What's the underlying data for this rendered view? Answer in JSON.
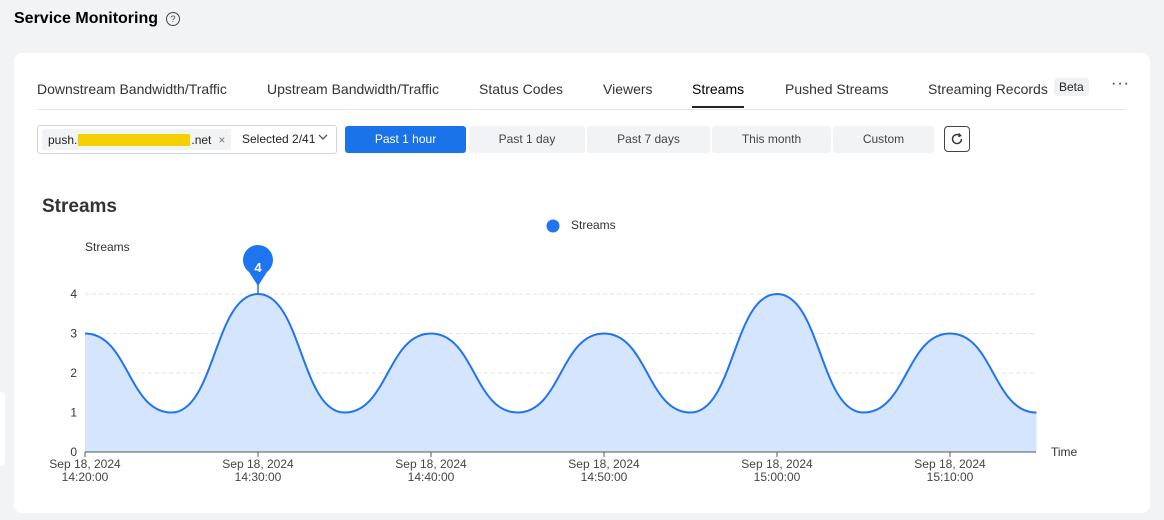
{
  "header": {
    "title": "Service Monitoring",
    "help_icon": "?"
  },
  "tabs": [
    {
      "label": "Downstream Bandwidth/Traffic",
      "active": false
    },
    {
      "label": "Upstream Bandwidth/Traffic",
      "active": false
    },
    {
      "label": "Status Codes",
      "active": false
    },
    {
      "label": "Viewers",
      "active": false
    },
    {
      "label": "Streams",
      "active": true
    },
    {
      "label": "Pushed Streams",
      "active": false
    },
    {
      "label": "Streaming Records",
      "active": false
    }
  ],
  "badge": "Beta",
  "more": "···",
  "filter": {
    "domain_prefix": "push.",
    "domain_suffix": ".net",
    "close": "×",
    "selected": "Selected 2/41"
  },
  "time_ranges": [
    {
      "label": "Past 1 hour",
      "active": true
    },
    {
      "label": "Past 1 day",
      "active": false
    },
    {
      "label": "Past 7 days",
      "active": false
    },
    {
      "label": "This month",
      "active": false
    },
    {
      "label": "Custom",
      "active": false
    }
  ],
  "colors": {
    "accent": "#1a73e8",
    "line": "#1f75f0",
    "area": "#d4e5fd"
  },
  "chart_data": {
    "type": "area",
    "title": "Streams",
    "ylabel": "Streams",
    "xlabel": "Time",
    "ylim": [
      0,
      4
    ],
    "yticks": [
      0,
      1,
      2,
      3,
      4
    ],
    "grid": true,
    "legend": {
      "position": "top-center",
      "entries": [
        "Streams"
      ]
    },
    "x_ticks": [
      [
        "Sep 18, 2024",
        "14:20:00"
      ],
      [
        "Sep 18, 2024",
        "14:30:00"
      ],
      [
        "Sep 18, 2024",
        "14:40:00"
      ],
      [
        "Sep 18, 2024",
        "14:50:00"
      ],
      [
        "Sep 18, 2024",
        "15:00:00"
      ],
      [
        "Sep 18, 2024",
        "15:10:00"
      ]
    ],
    "series": [
      {
        "name": "Streams",
        "x": [
          "14:20:00",
          "14:25:00",
          "14:30:00",
          "14:35:00",
          "14:40:00",
          "14:45:00",
          "14:50:00",
          "14:55:00",
          "15:00:00",
          "15:05:00",
          "15:10:00",
          "15:15:00"
        ],
        "values": [
          3,
          1,
          4,
          1,
          3,
          1,
          3,
          1,
          4,
          1,
          3,
          1
        ]
      }
    ],
    "tooltip": {
      "x": "14:30:00",
      "value": 4
    }
  }
}
